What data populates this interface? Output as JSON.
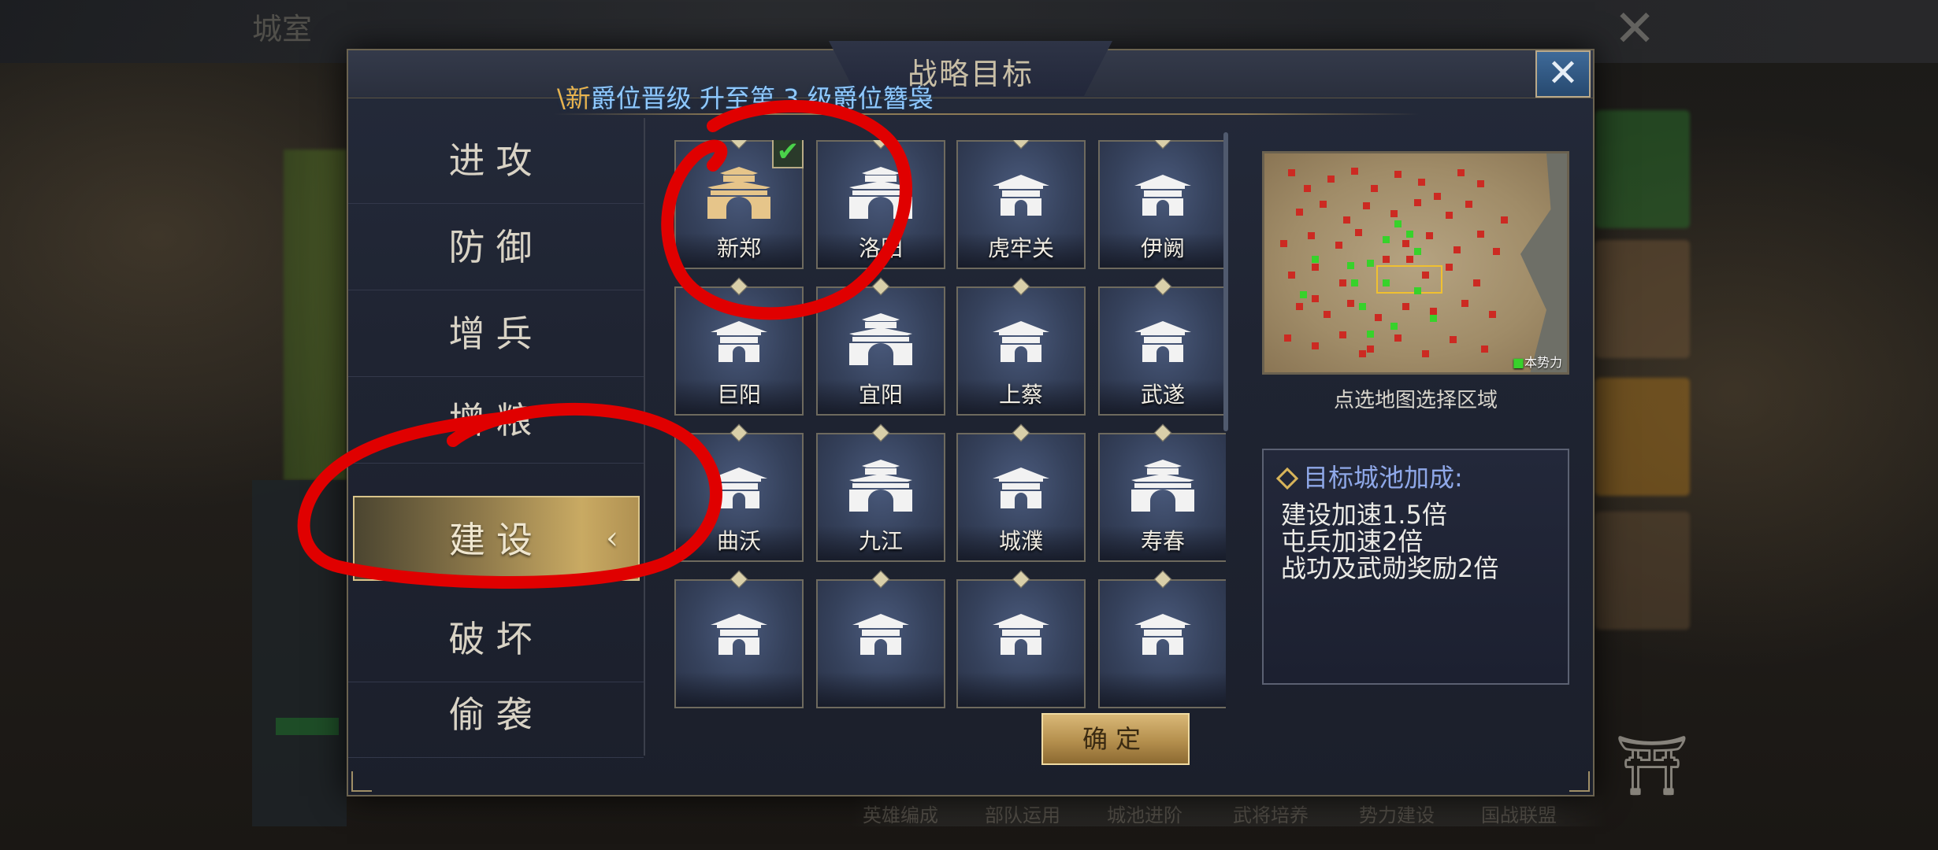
{
  "background": {
    "header_title": "城室",
    "close_glyph": "✕",
    "bottom_tabs": [
      "英雄编成",
      "部队运用",
      "城池进阶",
      "武将培养",
      "势力建设",
      "国战联盟"
    ]
  },
  "dialog": {
    "title": "战略目标",
    "close_glyph": "✕",
    "marquee_lead": "\\新",
    "marquee_text": "爵位晋级 升至第 3 级爵位簪袅"
  },
  "tabs": [
    {
      "label": "进攻"
    },
    {
      "label": "防御"
    },
    {
      "label": "增兵"
    },
    {
      "label": "增粮"
    },
    {
      "label": "建设",
      "active": true
    },
    {
      "label": "破坏"
    },
    {
      "label": "偷袭"
    }
  ],
  "tab_active_arrow": "‹",
  "cities": [
    {
      "name": "新郑",
      "gold": true,
      "checked": true,
      "type": "large"
    },
    {
      "name": "洛阳",
      "type": "large"
    },
    {
      "name": "虎牢关",
      "type": "small"
    },
    {
      "name": "伊阙",
      "type": "small"
    },
    {
      "name": "巨阳",
      "type": "small"
    },
    {
      "name": "宜阳",
      "type": "large"
    },
    {
      "name": "上蔡",
      "type": "small"
    },
    {
      "name": "武遂",
      "type": "small"
    },
    {
      "name": "曲沃",
      "type": "small"
    },
    {
      "name": "九江",
      "type": "large"
    },
    {
      "name": "城濮",
      "type": "small"
    },
    {
      "name": "寿春",
      "type": "large"
    },
    {
      "name": "",
      "type": "small"
    },
    {
      "name": "",
      "type": "small"
    },
    {
      "name": "",
      "type": "small"
    },
    {
      "name": "",
      "type": "small"
    }
  ],
  "check_glyph": "✔",
  "map": {
    "legend_label": "本势力",
    "legend_marker": "■",
    "hint": "点选地图选择区域"
  },
  "bonus": {
    "title": "目标城池加成:",
    "lines": [
      "建设加速1.5倍",
      "屯兵加速2倍",
      "战功及武勋奖励2倍"
    ]
  },
  "confirm_label": "确定",
  "colors": {
    "accent_gold": "#c9aa63",
    "annotation_red": "#e00000",
    "marquee_blue": "#8fc9ff",
    "bonus_title_blue": "#8fa8e8"
  }
}
